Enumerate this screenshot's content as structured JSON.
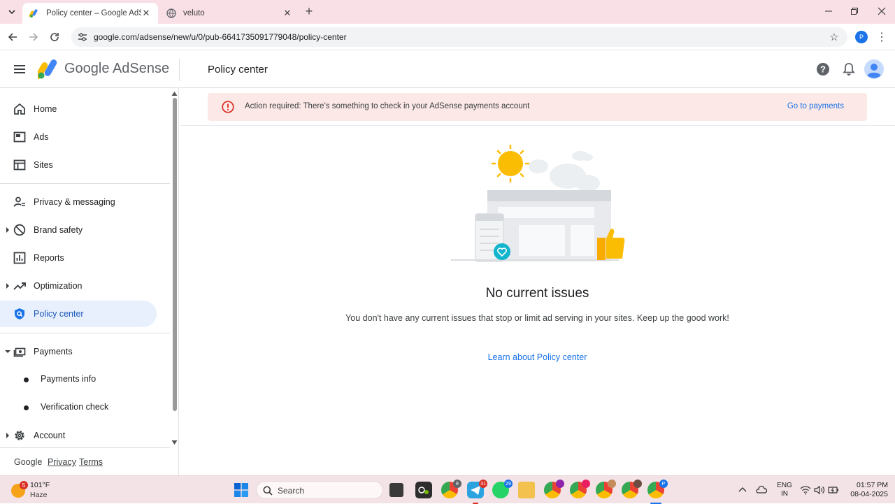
{
  "browser": {
    "tabs": [
      {
        "title": "Policy center – Google AdSense",
        "active": true
      },
      {
        "title": "veluto",
        "active": false
      }
    ],
    "url": "google.com/adsense/new/u/0/pub-6641735091779048/policy-center",
    "profile_initial": "P"
  },
  "header": {
    "brand": "Google AdSense",
    "page_title": "Policy center"
  },
  "sidebar": {
    "items": [
      {
        "label": "Home",
        "icon": "home-icon"
      },
      {
        "label": "Ads",
        "icon": "ads-icon"
      },
      {
        "label": "Sites",
        "icon": "sites-icon"
      },
      {
        "label": "Privacy & messaging",
        "icon": "privacy-icon"
      },
      {
        "label": "Brand safety",
        "icon": "block-icon"
      },
      {
        "label": "Reports",
        "icon": "reports-icon"
      },
      {
        "label": "Optimization",
        "icon": "trending-icon"
      },
      {
        "label": "Policy center",
        "icon": "policy-icon"
      },
      {
        "label": "Payments",
        "icon": "payments-icon"
      },
      {
        "label": "Account",
        "icon": "gear-icon"
      }
    ],
    "sub_items": [
      {
        "label": "Payments info"
      },
      {
        "label": "Verification check"
      }
    ],
    "footer": {
      "google": "Google",
      "privacy": "Privacy",
      "terms": "Terms"
    }
  },
  "banner": {
    "text": "Action required: There's something to check in your AdSense payments account",
    "link": "Go to payments"
  },
  "empty_state": {
    "title": "No current issues",
    "description": "You don't have any current issues that stop or limit ad serving in your sites. Keep up the good work!",
    "link": "Learn about Policy center"
  },
  "taskbar": {
    "weather_temp": "101°F",
    "weather_cond": "Haze",
    "weather_badge": "5",
    "search_placeholder": "Search",
    "badges": {
      "telegram": "31",
      "whatsapp": "29",
      "chrome_1": "8"
    },
    "lang_top": "ENG",
    "lang_bottom": "IN",
    "time": "01:57 PM",
    "date": "08-04-2025"
  },
  "colors": {
    "accent": "#1a73e8",
    "active_nav_bg": "#e8f0fe",
    "banner_bg": "#fce8e6",
    "warn": "#d93025",
    "tabbar_bg": "#f9dfe6"
  }
}
